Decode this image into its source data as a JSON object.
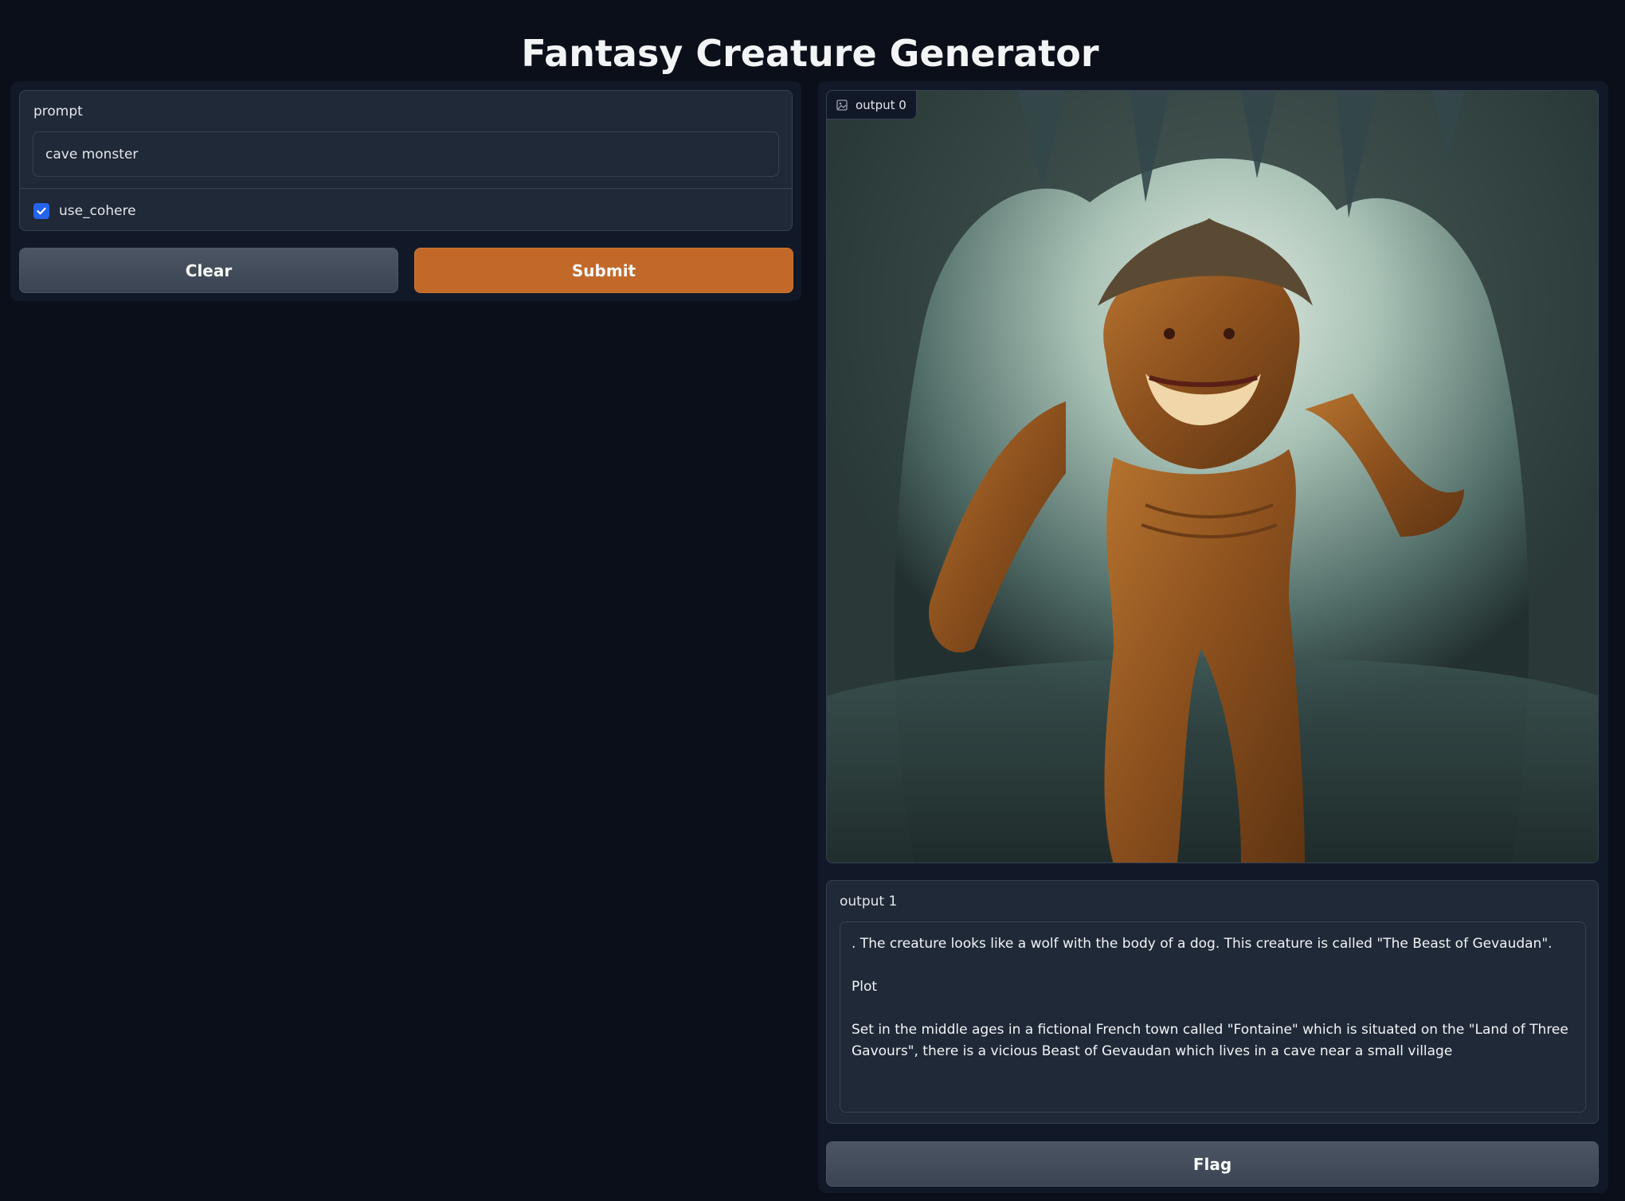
{
  "header": {
    "title": "Fantasy Creature Generator"
  },
  "inputs": {
    "prompt_label": "prompt",
    "prompt_value": "cave monster",
    "checkbox_label": "use_cohere",
    "checkbox_checked": true
  },
  "buttons": {
    "clear": "Clear",
    "submit": "Submit",
    "flag": "Flag"
  },
  "outputs": {
    "image_label": "output 0",
    "text_label": "output 1",
    "text_lines": [
      ". The creature looks like a wolf with the body of a dog. This creature is called \"The Beast of Gevaudan\".",
      "Plot",
      "Set in the middle ages in a fictional French town called \"Fontaine\" which is situated on the \"Land of Three Gavours\", there is a vicious Beast of Gevaudan which lives in a cave near a small village"
    ]
  },
  "colors": {
    "background": "#0b0f19",
    "panel": "#111827",
    "block": "#1f2937",
    "accent": "#c2692a",
    "checkbox": "#2563eb"
  },
  "icons": {
    "image_badge": "image-icon",
    "checkbox": "check-icon"
  }
}
